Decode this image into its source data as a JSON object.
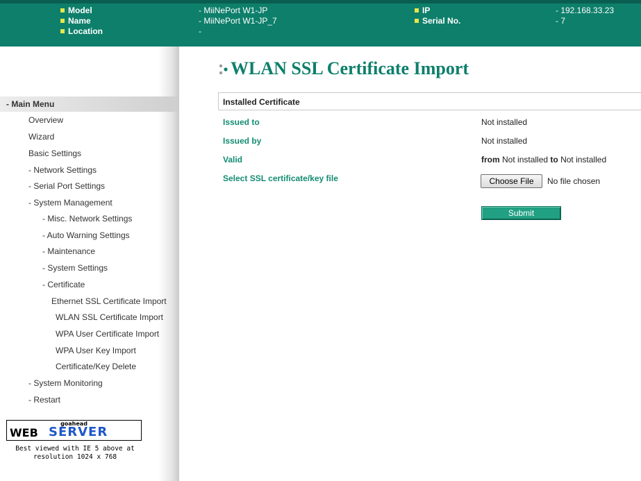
{
  "header": {
    "model_label": "Model",
    "model_value": "- MiiNePort W1-JP",
    "name_label": "Name",
    "name_value": "- MiiNePort W1-JP_7",
    "location_label": "Location",
    "location_value": "-",
    "ip_label": "IP",
    "ip_value": "- 192.168.33.23",
    "serial_label": "Serial No.",
    "serial_value": "- 7"
  },
  "sidebar": {
    "main_menu": "- Main Menu",
    "items": [
      "Overview",
      "Wizard",
      "Basic Settings",
      "- Network Settings",
      "- Serial Port Settings",
      "- System Management",
      "- Misc. Network Settings",
      "- Auto Warning Settings",
      "- Maintenance",
      "- System Settings",
      "- Certificate",
      "Ethernet SSL Certificate Import",
      "WLAN SSL Certificate Import",
      "WPA User Certificate Import",
      "WPA User Key Import",
      "Certificate/Key Delete",
      "- System Monitoring",
      "- Restart"
    ],
    "logo": {
      "goahead": "goahead",
      "web": "WEB",
      "server": "SERVER"
    },
    "best_viewed_line1": "Best viewed with IE 5 above at",
    "best_viewed_line2": "resolution 1024 x 768"
  },
  "main": {
    "title": "WLAN SSL Certificate Import",
    "section_header": "Installed Certificate",
    "issued_to_label": "Issued to",
    "issued_to_value": "Not installed",
    "issued_by_label": "Issued by",
    "issued_by_value": "Not installed",
    "valid_label": "Valid",
    "valid_from": "from",
    "valid_from_value": "Not installed",
    "valid_to": "to",
    "valid_to_value": "Not installed",
    "select_file_label": "Select SSL certificate/key file",
    "choose_file_button": "Choose File",
    "file_status": "No file chosen",
    "submit_button": "Submit"
  },
  "colors": {
    "header_bg": "#0d7f6b",
    "accent_green": "#138c73",
    "submit_bg": "#21a083",
    "bullet_yellow": "#e6e64a",
    "logo_blue": "#1f57c8"
  }
}
